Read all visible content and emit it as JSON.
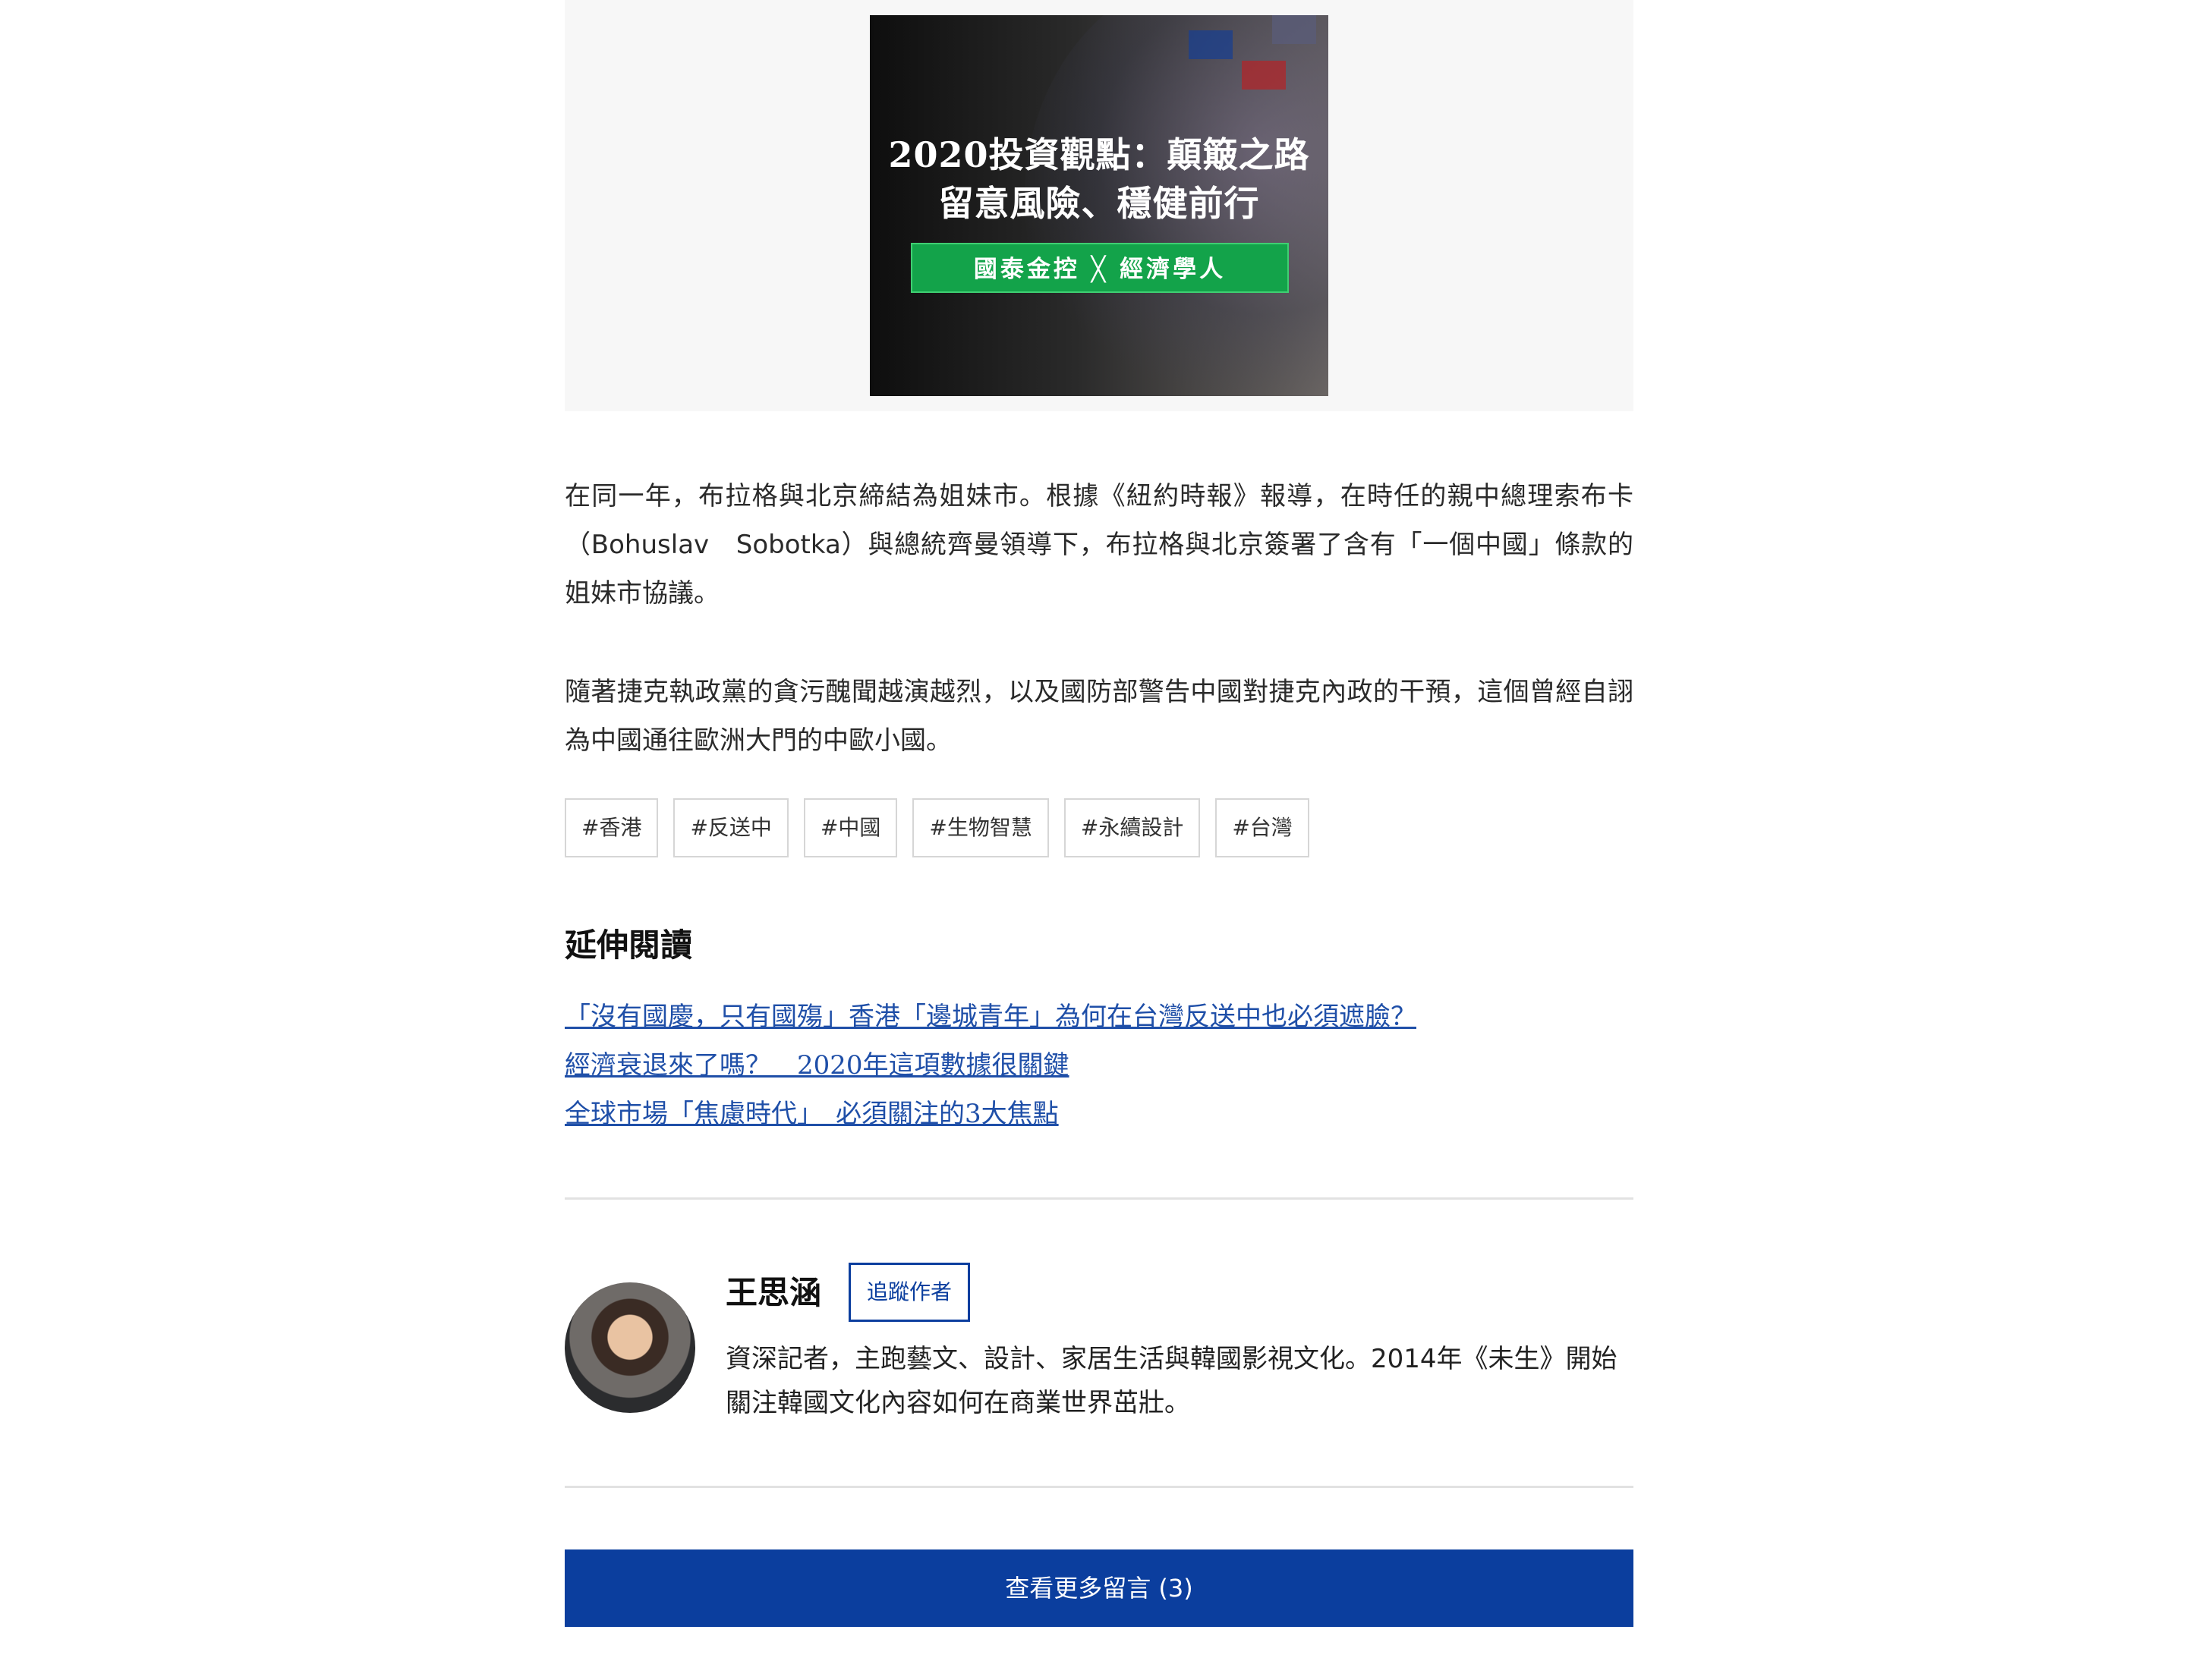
{
  "ad": {
    "title_line1": "2020投資觀點：顛簸之路",
    "title_line2": "留意風險、穩健前行",
    "banner": "國泰金控 ╳ 經濟學人"
  },
  "article": {
    "paragraph1": "在同一年，布拉格與北京締結為姐妹市。根據《紐約時報》報導，在時任的親中總理索布卡（Bohuslav　Sobotka）與總統齊曼領導下，布拉格與北京簽署了含有「一個中國」條款的姐妹市協議。",
    "paragraph2": "隨著捷克執政黨的貪污醜聞越演越烈，以及國防部警告中國對捷克內政的干預，這個曾經自詡為中國通往歐洲大門的中歐小國。"
  },
  "tags": [
    "#香港",
    "#反送中",
    "#中國",
    "#生物智慧",
    "#永續設計",
    "#台灣"
  ],
  "further_reading": {
    "title": "延伸閱讀",
    "links": [
      "「沒有國慶，只有國殤」香港「邊城青年」為何在台灣反送中也必須遮臉？",
      "經濟衰退來了嗎？　2020年這項數據很關鍵",
      "全球市場「焦慮時代」　必須關注的3大焦點"
    ]
  },
  "author": {
    "name": "王思涵",
    "follow_label": "追蹤作者",
    "bio": "資深記者，主跑藝文、設計、家居生活與韓國影視文化。2014年《未生》開始關注韓國文化內容如何在商業世界茁壯。"
  },
  "comments": {
    "more_label": "查看更多留言 (3)"
  },
  "colors": {
    "accent": "#0b3e9e",
    "link": "#1f4fa8",
    "ad_banner": "#13a34a"
  }
}
